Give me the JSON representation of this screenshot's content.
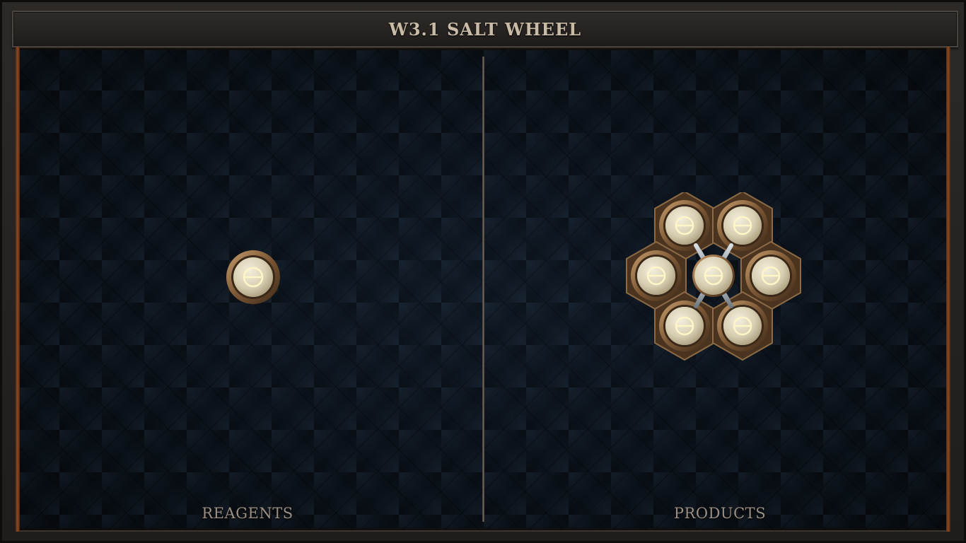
{
  "window": {
    "title": "W3.1 SALT WHEEL"
  },
  "panels": {
    "reagents_label": "REAGENTS",
    "products_label": "PRODUCTS"
  },
  "reagents": {
    "atoms": [
      {
        "element": "salt",
        "symbol": "⊖"
      }
    ]
  },
  "products": {
    "shape": "wheel",
    "atoms": [
      {
        "element": "salt",
        "symbol": "⊖",
        "role": "center"
      },
      {
        "element": "salt",
        "symbol": "⊖",
        "role": "upper-left"
      },
      {
        "element": "salt",
        "symbol": "⊖",
        "role": "upper-right"
      },
      {
        "element": "salt",
        "symbol": "⊖",
        "role": "left"
      },
      {
        "element": "salt",
        "symbol": "⊖",
        "role": "right"
      },
      {
        "element": "salt",
        "symbol": "⊖",
        "role": "lower-left"
      },
      {
        "element": "salt",
        "symbol": "⊖",
        "role": "lower-right"
      }
    ],
    "bond_count": 6
  },
  "colors": {
    "board_background": "#101a26",
    "title_text": "#c9bba6",
    "label_text": "#9a8f82",
    "atom_fill": "#e2dbc4",
    "atom_ring": "#8b6a45",
    "bond": "#a9b2b8"
  },
  "icons": {
    "atom": "salt-atom-icon"
  }
}
